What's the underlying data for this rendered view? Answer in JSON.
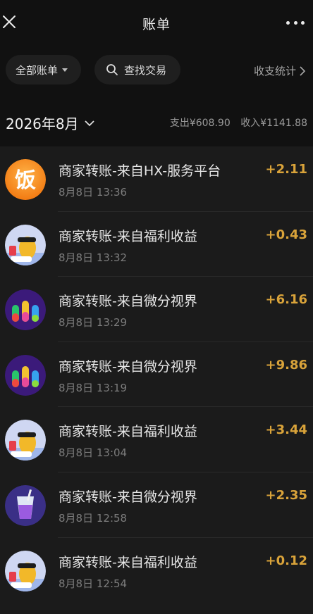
{
  "header": {
    "title": "账单"
  },
  "filters": {
    "all_bills": "全部账单",
    "search": "查找交易",
    "stats": "收支统计"
  },
  "month": {
    "label": "2026年8月",
    "expense": "支出¥608.90",
    "income": "收入¥1141.88"
  },
  "transactions": [
    {
      "title": "商家转账-来自HX-服务平台",
      "time": "8月8日 13:36",
      "amount": "+2.11",
      "icon": "fan-rice-icon"
    },
    {
      "title": "商家转账-来自福利收益",
      "time": "8月8日 13:32",
      "amount": "+0.43",
      "icon": "cartoon-cat-icon"
    },
    {
      "title": "商家转账-来自微分视界",
      "time": "8月8日 13:29",
      "amount": "+6.16",
      "icon": "color-bottles-icon"
    },
    {
      "title": "商家转账-来自微分视界",
      "time": "8月8日 13:19",
      "amount": "+9.86",
      "icon": "color-bottles-icon"
    },
    {
      "title": "商家转账-来自福利收益",
      "time": "8月8日 13:04",
      "amount": "+3.44",
      "icon": "cartoon-cat-icon"
    },
    {
      "title": "商家转账-来自微分视界",
      "time": "8月8日 12:58",
      "amount": "+2.35",
      "icon": "juice-cup-icon"
    },
    {
      "title": "商家转账-来自福利收益",
      "time": "8月8日 12:54",
      "amount": "+0.12",
      "icon": "cartoon-cat-icon"
    }
  ],
  "colors": {
    "background": "#111111",
    "list_background": "#1b1b1b",
    "amount_income": "#d9a33a"
  }
}
